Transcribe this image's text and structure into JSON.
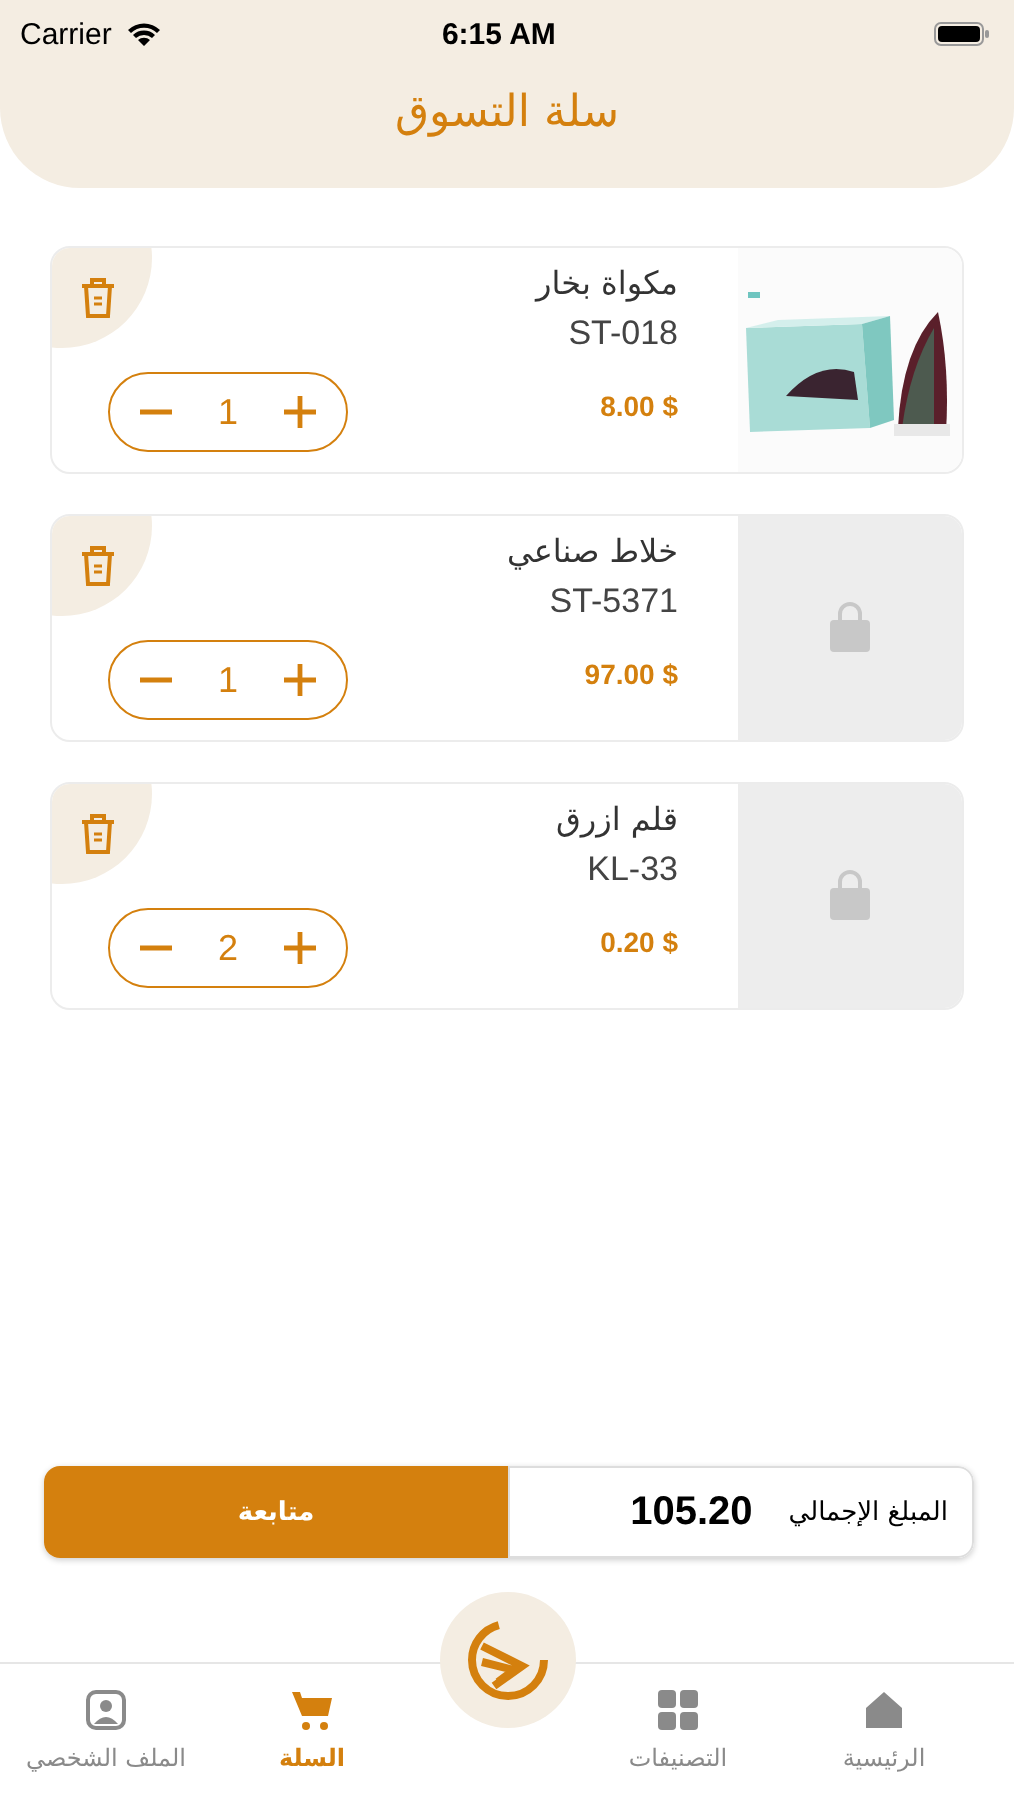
{
  "status_bar": {
    "carrier": "Carrier",
    "time": "6:15 AM"
  },
  "header": {
    "title": "سلة التسوق"
  },
  "cart_items": [
    {
      "name": "مكواة بخار",
      "code": "ST-018",
      "price": "8.00 $",
      "quantity": "1"
    },
    {
      "name": "خلاط صناعي",
      "code": "ST-5371",
      "price": "97.00 $",
      "quantity": "1",
      "kind": "placeholder"
    },
    {
      "name": "قلم ازرق",
      "code": "KL-33",
      "price": "0.20 $",
      "quantity": "2",
      "kind": "placeholder"
    }
  ],
  "total": {
    "label": "المبلغ الإجمالي",
    "amount": "105.20",
    "button": "متابعة"
  },
  "tab_bar": [
    {
      "label": "الرئيسية",
      "kind": "home",
      "selected": false
    },
    {
      "label": "التصنيفات",
      "kind": "grid",
      "selected": false
    },
    {
      "label": "السلة",
      "kind": "cart",
      "selected": true
    },
    {
      "label": "الملف الشخصي",
      "kind": "profile",
      "selected": false
    }
  ]
}
